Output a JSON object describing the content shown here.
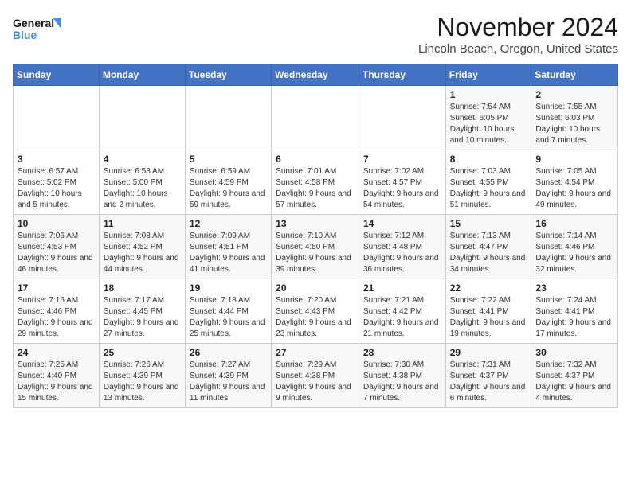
{
  "logo": {
    "line1": "General",
    "line2": "Blue"
  },
  "title": "November 2024",
  "location": "Lincoln Beach, Oregon, United States",
  "weekdays": [
    "Sunday",
    "Monday",
    "Tuesday",
    "Wednesday",
    "Thursday",
    "Friday",
    "Saturday"
  ],
  "weeks": [
    [
      {
        "day": "",
        "info": ""
      },
      {
        "day": "",
        "info": ""
      },
      {
        "day": "",
        "info": ""
      },
      {
        "day": "",
        "info": ""
      },
      {
        "day": "",
        "info": ""
      },
      {
        "day": "1",
        "info": "Sunrise: 7:54 AM\nSunset: 6:05 PM\nDaylight: 10 hours and 10 minutes."
      },
      {
        "day": "2",
        "info": "Sunrise: 7:55 AM\nSunset: 6:03 PM\nDaylight: 10 hours and 7 minutes."
      }
    ],
    [
      {
        "day": "3",
        "info": "Sunrise: 6:57 AM\nSunset: 5:02 PM\nDaylight: 10 hours and 5 minutes."
      },
      {
        "day": "4",
        "info": "Sunrise: 6:58 AM\nSunset: 5:00 PM\nDaylight: 10 hours and 2 minutes."
      },
      {
        "day": "5",
        "info": "Sunrise: 6:59 AM\nSunset: 4:59 PM\nDaylight: 9 hours and 59 minutes."
      },
      {
        "day": "6",
        "info": "Sunrise: 7:01 AM\nSunset: 4:58 PM\nDaylight: 9 hours and 57 minutes."
      },
      {
        "day": "7",
        "info": "Sunrise: 7:02 AM\nSunset: 4:57 PM\nDaylight: 9 hours and 54 minutes."
      },
      {
        "day": "8",
        "info": "Sunrise: 7:03 AM\nSunset: 4:55 PM\nDaylight: 9 hours and 51 minutes."
      },
      {
        "day": "9",
        "info": "Sunrise: 7:05 AM\nSunset: 4:54 PM\nDaylight: 9 hours and 49 minutes."
      }
    ],
    [
      {
        "day": "10",
        "info": "Sunrise: 7:06 AM\nSunset: 4:53 PM\nDaylight: 9 hours and 46 minutes."
      },
      {
        "day": "11",
        "info": "Sunrise: 7:08 AM\nSunset: 4:52 PM\nDaylight: 9 hours and 44 minutes."
      },
      {
        "day": "12",
        "info": "Sunrise: 7:09 AM\nSunset: 4:51 PM\nDaylight: 9 hours and 41 minutes."
      },
      {
        "day": "13",
        "info": "Sunrise: 7:10 AM\nSunset: 4:50 PM\nDaylight: 9 hours and 39 minutes."
      },
      {
        "day": "14",
        "info": "Sunrise: 7:12 AM\nSunset: 4:48 PM\nDaylight: 9 hours and 36 minutes."
      },
      {
        "day": "15",
        "info": "Sunrise: 7:13 AM\nSunset: 4:47 PM\nDaylight: 9 hours and 34 minutes."
      },
      {
        "day": "16",
        "info": "Sunrise: 7:14 AM\nSunset: 4:46 PM\nDaylight: 9 hours and 32 minutes."
      }
    ],
    [
      {
        "day": "17",
        "info": "Sunrise: 7:16 AM\nSunset: 4:46 PM\nDaylight: 9 hours and 29 minutes."
      },
      {
        "day": "18",
        "info": "Sunrise: 7:17 AM\nSunset: 4:45 PM\nDaylight: 9 hours and 27 minutes."
      },
      {
        "day": "19",
        "info": "Sunrise: 7:18 AM\nSunset: 4:44 PM\nDaylight: 9 hours and 25 minutes."
      },
      {
        "day": "20",
        "info": "Sunrise: 7:20 AM\nSunset: 4:43 PM\nDaylight: 9 hours and 23 minutes."
      },
      {
        "day": "21",
        "info": "Sunrise: 7:21 AM\nSunset: 4:42 PM\nDaylight: 9 hours and 21 minutes."
      },
      {
        "day": "22",
        "info": "Sunrise: 7:22 AM\nSunset: 4:41 PM\nDaylight: 9 hours and 19 minutes."
      },
      {
        "day": "23",
        "info": "Sunrise: 7:24 AM\nSunset: 4:41 PM\nDaylight: 9 hours and 17 minutes."
      }
    ],
    [
      {
        "day": "24",
        "info": "Sunrise: 7:25 AM\nSunset: 4:40 PM\nDaylight: 9 hours and 15 minutes."
      },
      {
        "day": "25",
        "info": "Sunrise: 7:26 AM\nSunset: 4:39 PM\nDaylight: 9 hours and 13 minutes."
      },
      {
        "day": "26",
        "info": "Sunrise: 7:27 AM\nSunset: 4:39 PM\nDaylight: 9 hours and 11 minutes."
      },
      {
        "day": "27",
        "info": "Sunrise: 7:29 AM\nSunset: 4:38 PM\nDaylight: 9 hours and 9 minutes."
      },
      {
        "day": "28",
        "info": "Sunrise: 7:30 AM\nSunset: 4:38 PM\nDaylight: 9 hours and 7 minutes."
      },
      {
        "day": "29",
        "info": "Sunrise: 7:31 AM\nSunset: 4:37 PM\nDaylight: 9 hours and 6 minutes."
      },
      {
        "day": "30",
        "info": "Sunrise: 7:32 AM\nSunset: 4:37 PM\nDaylight: 9 hours and 4 minutes."
      }
    ]
  ]
}
